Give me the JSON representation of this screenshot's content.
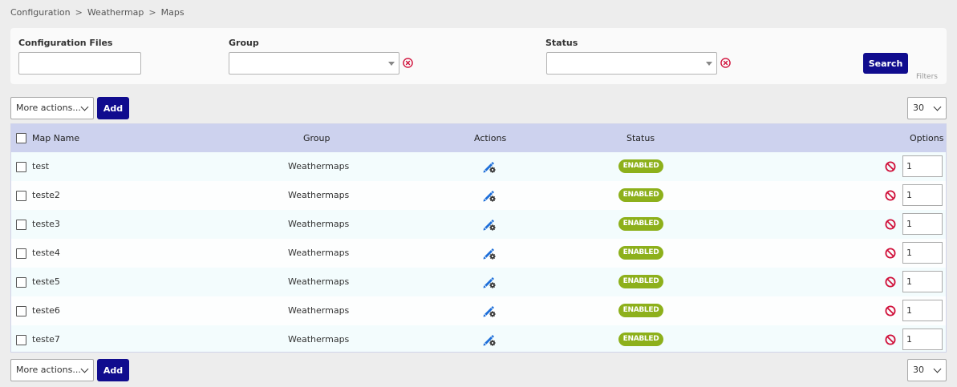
{
  "breadcrumb": [
    "Configuration",
    "Weathermap",
    "Maps"
  ],
  "breadcrumb_sep": ">",
  "filters": {
    "config_files_label": "Configuration Files",
    "config_files_value": "",
    "group_label": "Group",
    "group_value": "",
    "status_label": "Status",
    "status_value": "",
    "search_label": "Search",
    "filters_label": "Filters"
  },
  "actions_top": {
    "more_actions": "More actions...",
    "add": "Add",
    "page_size": "30"
  },
  "actions_bottom": {
    "more_actions": "More actions...",
    "add": "Add",
    "page_size": "30"
  },
  "table": {
    "columns": {
      "name": "Map Name",
      "group": "Group",
      "actions": "Actions",
      "status": "Status",
      "options": "Options"
    },
    "rows": [
      {
        "name": "test",
        "group": "Weathermaps",
        "status": "ENABLED",
        "order": "1"
      },
      {
        "name": "teste2",
        "group": "Weathermaps",
        "status": "ENABLED",
        "order": "1"
      },
      {
        "name": "teste3",
        "group": "Weathermaps",
        "status": "ENABLED",
        "order": "1"
      },
      {
        "name": "teste4",
        "group": "Weathermaps",
        "status": "ENABLED",
        "order": "1"
      },
      {
        "name": "teste5",
        "group": "Weathermaps",
        "status": "ENABLED",
        "order": "1"
      },
      {
        "name": "teste6",
        "group": "Weathermaps",
        "status": "ENABLED",
        "order": "1"
      },
      {
        "name": "teste7",
        "group": "Weathermaps",
        "status": "ENABLED",
        "order": "1"
      }
    ]
  },
  "colors": {
    "primary_button": "#100c8e",
    "enabled_badge": "#8db01b",
    "header_bg": "#cdd2ee",
    "clear_icon": "#d0103a",
    "disable_icon": "#d0103a",
    "action_icon": "#1e6fd9"
  },
  "icons": {
    "clear": "circle-x-icon",
    "action": "pencil-gear-icon",
    "disable": "ban-icon",
    "dropdown": "chevron-down-icon"
  }
}
